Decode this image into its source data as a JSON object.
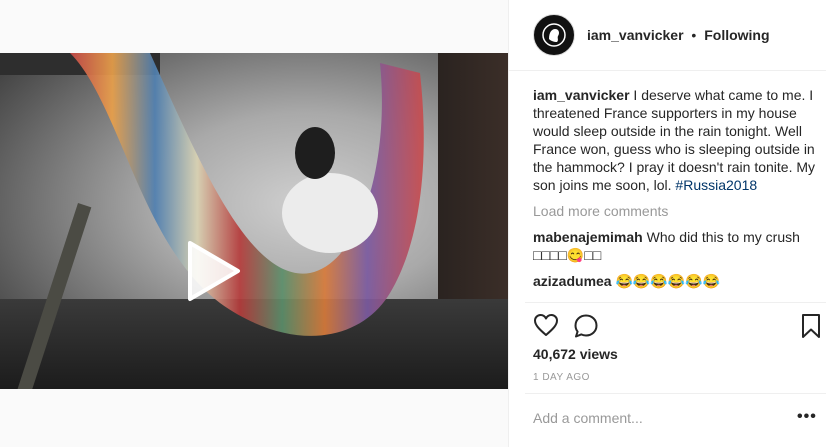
{
  "post": {
    "username": "iam_vanvicker",
    "separator": "•",
    "follow_status": "Following",
    "caption": "I deserve what came to me. I threatened France supporters in my house would sleep outside in the rain tonight. Well France won, guess who is sleeping outside in the hammock? I pray it doesn't rain tonite. My son joins me soon, lol.",
    "hashtag": "#Russia2018",
    "load_more": "Load more comments",
    "comments": [
      {
        "user": "mabenajemimah",
        "text": "Who did this to my crush",
        "extra": "□□□□😋□□"
      },
      {
        "user": "azizadumea",
        "text": "😂😂😂😂😂😂"
      }
    ],
    "views": "40,672 views",
    "time": "1 DAY AGO",
    "add_comment_placeholder": "Add a comment...",
    "more_label": "•••"
  },
  "icons": {
    "like": "heart-icon",
    "comment": "comment-icon",
    "save": "bookmark-icon",
    "play": "play-icon"
  },
  "colors": {
    "text": "#262626",
    "muted": "#999999",
    "hashtag": "#003569"
  }
}
